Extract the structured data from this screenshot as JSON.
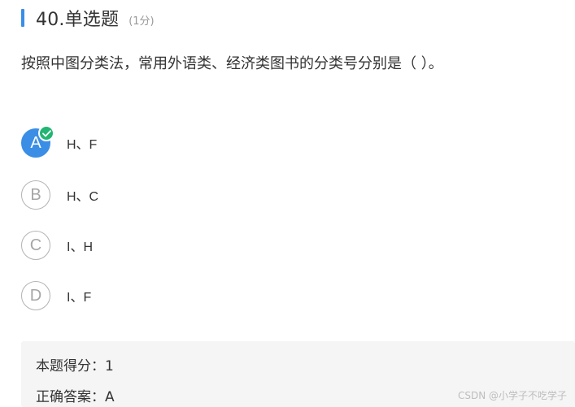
{
  "question": {
    "title": "40.单选题",
    "score": "(1分)",
    "stem": "按照中图分类法，常用外语类、经济类图书的分类号分别是（ ）。"
  },
  "options": [
    {
      "letter": "A",
      "text": "H、F"
    },
    {
      "letter": "B",
      "text": "H、C"
    },
    {
      "letter": "C",
      "text": "I、H"
    },
    {
      "letter": "D",
      "text": "I、F"
    }
  ],
  "result": {
    "score_line": "本题得分：1",
    "answer_line": "正确答案：A"
  },
  "watermark": "CSDN @小学子不吃学子",
  "colors": {
    "accent": "#3a8ee6",
    "correct": "#22b573"
  }
}
